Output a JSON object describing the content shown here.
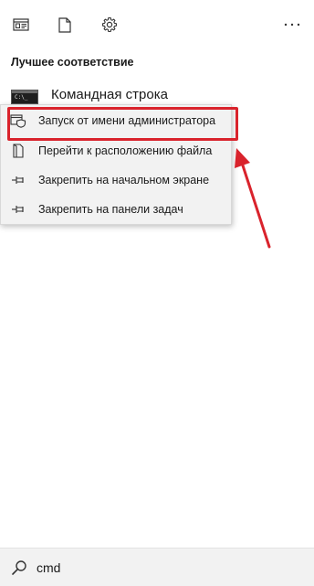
{
  "toolbar": {
    "icons": [
      "document-view-icon",
      "file-icon",
      "gear-icon",
      "more-icon"
    ],
    "more_label": "..."
  },
  "best_match": {
    "section_title": "Лучшее соответствие",
    "app_name": "Командная строка",
    "app_icon_text": "C:\\_"
  },
  "context_menu": {
    "items": [
      {
        "label": "Запуск от имени администратора",
        "icon": "shield-window-icon"
      },
      {
        "label": "Перейти к расположению файла",
        "icon": "file-location-icon"
      },
      {
        "label": "Закрепить на начальном экране",
        "icon": "pin-icon"
      },
      {
        "label": "Закрепить на панели задач",
        "icon": "pin-icon"
      }
    ]
  },
  "annotation": {
    "highlight_color": "#d9232c",
    "arrow_color": "#d9232c"
  },
  "search": {
    "value": "cmd"
  }
}
